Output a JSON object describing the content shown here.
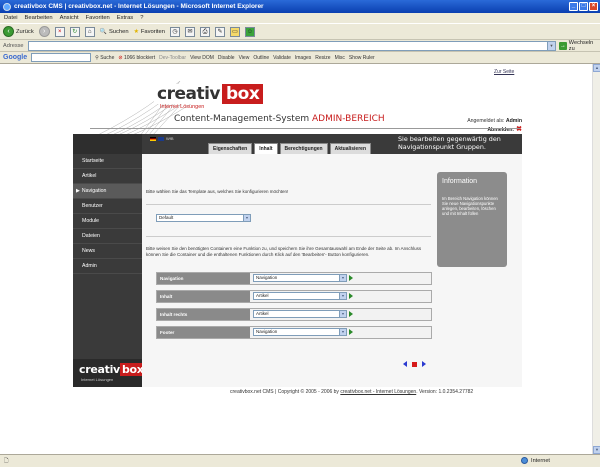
{
  "window": {
    "title": "creativbox CMS | creativbox.net - Internet Lösungen - Microsoft Internet Explorer"
  },
  "menu": [
    "Datei",
    "Bearbeiten",
    "Ansicht",
    "Favoriten",
    "Extras",
    "?"
  ],
  "toolbar": {
    "back": "Zurück",
    "search": "Suchen",
    "favorites": "Favoriten"
  },
  "address": {
    "label": "Adresse",
    "value": "",
    "go": "Wechseln zu"
  },
  "google_bar": {
    "logo": "Google",
    "search_label": "Suche",
    "blocked": "1066 blockiert",
    "devtoolbar": "Dev-Toolbar",
    "items": [
      "View DOM",
      "Disable",
      "View",
      "Outline",
      "Validate",
      "Images",
      "Resize",
      "Misc",
      "Show Ruler"
    ]
  },
  "site": {
    "back_link": "Zur Seite",
    "logo_word": "creativ",
    "logo_red": "box",
    "logo_sub": "Internet Lösungen",
    "cms_title": "Content-Management-System",
    "cms_title_red": "ADMIN-BEREICH",
    "logged_in_label": "Angemeldet als:",
    "logged_in_user": "Admin",
    "logout": "Abmelden:",
    "lang_label": "WfB"
  },
  "sidebar": {
    "items": [
      {
        "label": "Startseite",
        "active": false
      },
      {
        "label": "Artikel",
        "active": false
      },
      {
        "label": "Navigation",
        "active": true
      },
      {
        "label": "Benutzer",
        "active": false
      },
      {
        "label": "Module",
        "active": false
      },
      {
        "label": "Dateien",
        "active": false
      },
      {
        "label": "News",
        "active": false
      },
      {
        "label": "Admin",
        "active": false
      }
    ],
    "logo_word": "creativ",
    "logo_red": "box",
    "logo_sub": "Internet Lösungen"
  },
  "tabs": [
    {
      "label": "Eigenschaften",
      "active": false
    },
    {
      "label": "Inhalt",
      "active": true
    },
    {
      "label": "Berechtigungen",
      "active": false
    },
    {
      "label": "Aktualisieren",
      "active": false
    }
  ],
  "top_message": "Sie bearbeiten gegenwärtig den Navigationspunkt Gruppen.",
  "content": {
    "template_prompt": "Bitte wählen Sie das Template aus, welches Sie konfigurieren möchten!",
    "template_select": "Default",
    "description": "Bitte weisen Sie den benötigten Containern eine Funktion zu, und speichern Sie ihre Gesamtauswahl am Ende der Seite ab. Im Anschluss können Sie die Container und die enthaltenen Funktionen durch Klick auf den 'Bearbeiten'- Button konfigurieren.",
    "rows": [
      {
        "label": "Navigation",
        "value": "Navigation"
      },
      {
        "label": "Inhalt",
        "value": "Artikel"
      },
      {
        "label": "Inhalt rechts",
        "value": "Artikel"
      },
      {
        "label": "Footer",
        "value": "Navigation"
      }
    ]
  },
  "info": {
    "title": "Information",
    "text": "Im Bereich Navigation können Sie neue Navigationspunkte anlegen, bearbeiten, löschen und mit Inhalt füllen"
  },
  "footer": {
    "text": "creativbox.net CMS | Copyright © 2005 - 2006 by",
    "link": "creativbox.net - Internet Lösungen",
    "version": ". Version: 1.0.2354.27782"
  },
  "status": {
    "zone": "Internet"
  },
  "colors": {
    "accent_red": "#c81d1d",
    "dark_panel": "#3a3a3a",
    "info_gray": "#8c8c8c"
  }
}
